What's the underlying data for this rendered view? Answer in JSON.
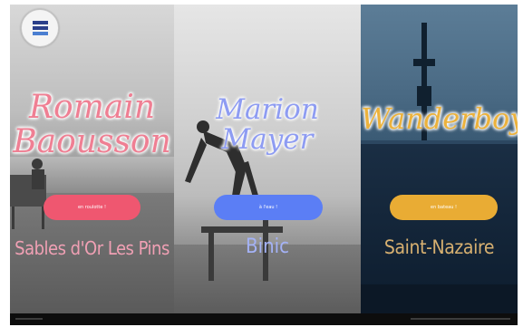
{
  "logo": {
    "icon": "site-logo-icon"
  },
  "panels": [
    {
      "id": "romain",
      "title_line1": "Romain",
      "title_line2": "Baousson",
      "cta_label": "en roulotte !",
      "place": "Sables d'Or Les Pins",
      "title_color": "#ef7f93",
      "cta_color": "#ef5770",
      "place_color": "#f0a0b4"
    },
    {
      "id": "marion",
      "title_line1": "Marion",
      "title_line2": "Mayer",
      "cta_label": "à l'eau !",
      "place": "Binic",
      "title_color": "#8e9cf2",
      "cta_color": "#5b7ef5",
      "place_color": "#a4b2f6"
    },
    {
      "id": "wanderboy",
      "title_line1": "Wanderboy",
      "cta_label": "en bateau !",
      "place": "Saint-Nazaire",
      "title_color": "#ecb23c",
      "cta_color": "#e9ac34",
      "place_color": "#d7b070"
    }
  ]
}
